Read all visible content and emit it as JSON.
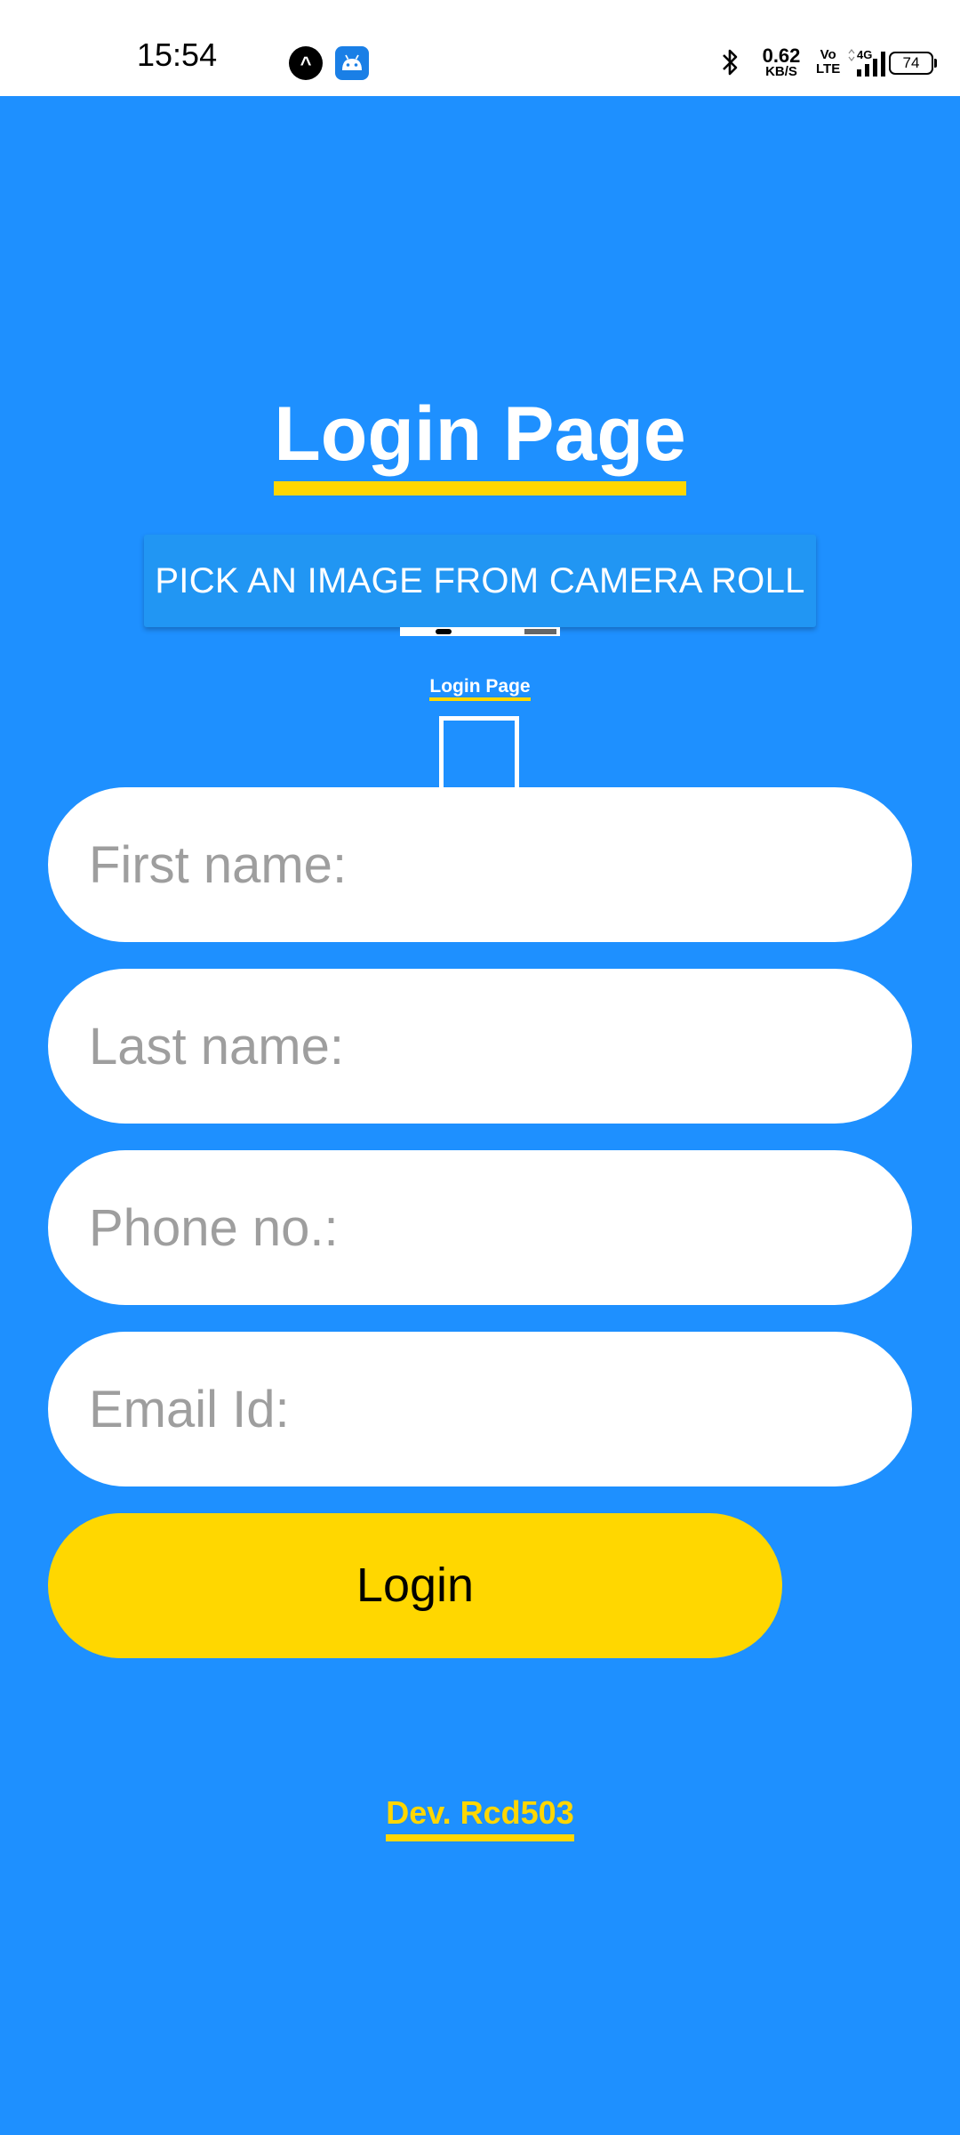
{
  "status_bar": {
    "time": "15:54",
    "app_icons": [
      "expo-app-icon",
      "android-app-icon"
    ],
    "network_speed": "0.62",
    "network_speed_unit": "KB/S",
    "volte_top": "Vo",
    "volte_bottom": "LTE",
    "network_type": "4G",
    "battery": "74"
  },
  "page": {
    "title": "Login Page",
    "pick_image_button": "PICK AN IMAGE FROM CAMERA ROLL",
    "preview": {
      "title": "Login Page"
    },
    "fields": {
      "first_name_placeholder": "First name:",
      "last_name_placeholder": "Last name:",
      "phone_placeholder": "Phone no.:",
      "email_placeholder": "Email Id:"
    },
    "login_button": "Login",
    "footer": "Dev. Rcd503"
  },
  "colors": {
    "background": "#1E90FF",
    "accent": "#FFD700",
    "button": "#2196F3",
    "field": "#FFFFFF"
  }
}
